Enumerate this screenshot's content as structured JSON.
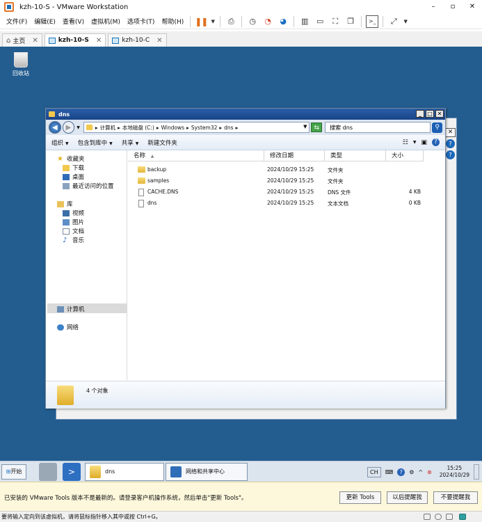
{
  "vmware": {
    "title": "kzh-10-S - VMware Workstation",
    "menu": [
      "文件(F)",
      "编辑(E)",
      "查看(V)",
      "虚拟机(M)",
      "选项卡(T)",
      "帮助(H)"
    ],
    "tabs": [
      {
        "label": "主页"
      },
      {
        "label": "kzh-10-S"
      },
      {
        "label": "kzh-10-C"
      }
    ]
  },
  "desktop": {
    "recycle_label": "回收站"
  },
  "explorer": {
    "title": "dns",
    "breadcrumb": [
      "计算机",
      "本地磁盘 (C:)",
      "Windows",
      "System32",
      "dns"
    ],
    "search_value": "搜索 dns",
    "commands": [
      "组织",
      "包含到库中",
      "共享",
      "新建文件夹"
    ],
    "nav": {
      "favorites": "收藏夹",
      "downloads": "下载",
      "desktop": "桌面",
      "recent": "最近访问的位置",
      "libraries": "库",
      "videos": "视频",
      "pictures": "图片",
      "documents": "文档",
      "music": "音乐",
      "computer": "计算机",
      "network": "网络"
    },
    "columns": [
      "名称",
      "修改日期",
      "类型",
      "大小"
    ],
    "files": [
      {
        "name": "backup",
        "date": "2024/10/29 15:25",
        "type": "文件夹",
        "size": "",
        "kind": "folder"
      },
      {
        "name": "samples",
        "date": "2024/10/29 15:25",
        "type": "文件夹",
        "size": "",
        "kind": "folder"
      },
      {
        "name": "CACHE.DNS",
        "date": "2024/10/29 15:25",
        "type": "DNS 文件",
        "size": "4 KB",
        "kind": "file"
      },
      {
        "name": "dns",
        "date": "2024/10/29 15:25",
        "type": "文本文档",
        "size": "0 KB",
        "kind": "file"
      }
    ],
    "item_count": "4 个对象"
  },
  "taskbar": {
    "start": "开始",
    "explorer_task": "dns",
    "network_task": "网络和共享中心",
    "lang": "CH",
    "time": "15:25",
    "date": "2024/10/29"
  },
  "notification": {
    "message": "已安装的 VMware Tools 版本不是最新的。请登录客户机操作系统，然后单击\"更新 Tools\"。",
    "update_btn": "更新 Tools",
    "later_btn": "以后提醒我",
    "never_btn": "不要提醒我"
  },
  "status": {
    "text": "要将输入定向到该虚拟机，请将鼠标指针移入其中或按 Ctrl+G。"
  },
  "colors": {
    "desktop": "#235c8f",
    "title_bar": "#1a4488",
    "pause": "#e06f1c",
    "notification_bg": "#fdf8dc"
  }
}
